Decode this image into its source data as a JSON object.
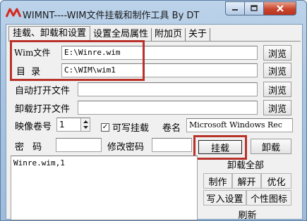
{
  "window": {
    "title": "WIMNT----WIM文件挂载和制作工具   By  DT",
    "icon": "app-logo-icon",
    "controls": {
      "minimize": "minimize-icon",
      "maximize": "maximize-icon",
      "close": "close-icon"
    }
  },
  "tabs": [
    {
      "label": "挂载、卸载和设置"
    },
    {
      "label": "设置全局属性"
    },
    {
      "label": "附加页"
    },
    {
      "label": "关于"
    }
  ],
  "form": {
    "wim_file": {
      "label": "Wim文件",
      "value": "E:\\Winre.wim",
      "browse": "浏览"
    },
    "directory": {
      "label": "目  录",
      "value": "C:\\WIM\\wim1",
      "browse": "浏览"
    },
    "auto_open": {
      "label": "自动打开文件",
      "value": "",
      "browse": "浏览"
    },
    "unmount_open": {
      "label": "卸载打开文件",
      "value": "",
      "browse": "浏览"
    },
    "image_index": {
      "label": "映像卷号",
      "value": "1"
    },
    "writable": {
      "label": "可写挂载",
      "checked": true,
      "check_mark": "✓"
    },
    "volume_name": {
      "label": "卷名",
      "value": "Microsoft Windows Rec"
    },
    "password": {
      "label": "密  码",
      "value": ""
    },
    "change_password": {
      "label": "修改密码",
      "value": ""
    }
  },
  "buttons": {
    "mount": "挂载",
    "unmount": "卸载",
    "unmount_all": "卸载全部",
    "make": "制作",
    "extract": "解开",
    "optimize": "优化",
    "write_settings": "写入设置",
    "custom_icon": "个性图标",
    "refresh": "刷新"
  },
  "mounted_list": [
    "Winre.wim,1"
  ],
  "colors": {
    "highlight_box": "#b8322a",
    "title_bar": "#a9c4e2"
  }
}
